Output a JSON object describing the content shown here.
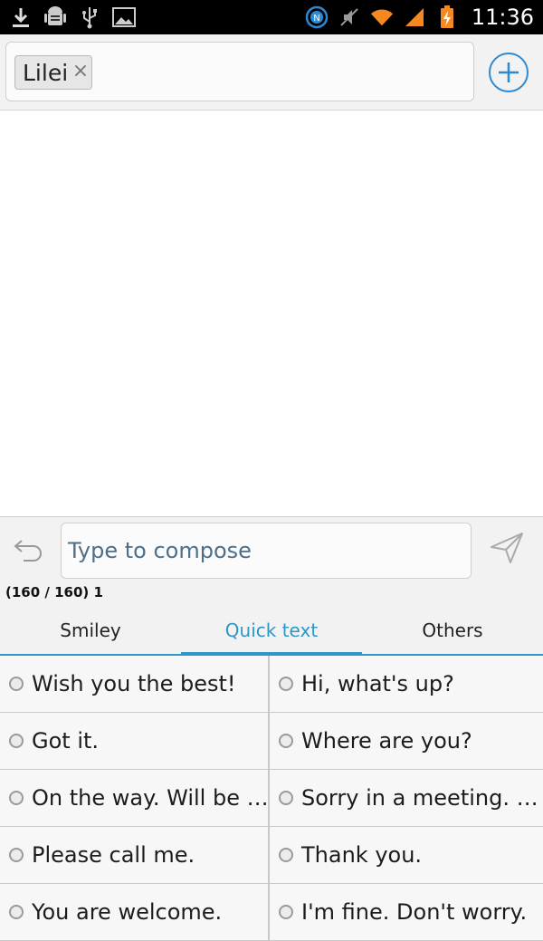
{
  "status_bar": {
    "time": "11:36",
    "left_icons": [
      "download-icon",
      "android-debug-icon",
      "usb-icon",
      "image-icon"
    ],
    "right_icons": [
      "nfc-icon",
      "mute-icon",
      "wifi-icon",
      "signal-icon",
      "battery-charging-icon"
    ]
  },
  "recipient": {
    "chip_label": "Lilei",
    "chip_remove": "×"
  },
  "compose": {
    "placeholder": "Type to compose",
    "char_count": "(160 / 160) 1"
  },
  "tabs": [
    {
      "label": "Smiley",
      "active": false
    },
    {
      "label": "Quick text",
      "active": true
    },
    {
      "label": "Others",
      "active": false
    }
  ],
  "quick_texts": [
    "Wish you the best!",
    "Hi, what's up?",
    "Got it.",
    "Where are you?",
    "On the way. Will be …",
    "Sorry in a meeting. …",
    "Please call me.",
    "Thank you.",
    "You are welcome.",
    "I'm fine. Don't worry."
  ],
  "colors": {
    "accent": "#2f96c8",
    "add_button": "#2a8ad6",
    "placeholder_text": "#4d6f89"
  }
}
